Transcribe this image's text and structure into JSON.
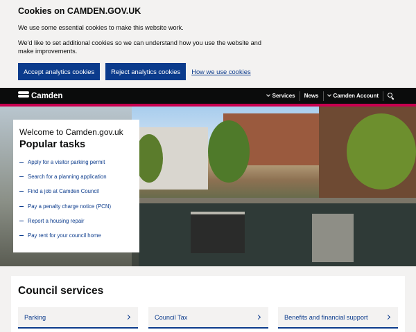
{
  "cookie_banner": {
    "title": "Cookies on CAMDEN.GOV.UK",
    "text1": "We use some essential cookies to make this website work.",
    "text2": "We'd like to set additional cookies so we can understand how you use the website and make improvements.",
    "accept_label": "Accept analytics cookies",
    "reject_label": "Reject analytics cookies",
    "link_label": "How we use cookies"
  },
  "header": {
    "logo_text": "Camden",
    "nav": [
      "Services",
      "News",
      "Camden Account"
    ],
    "search_icon": "search-icon",
    "accent_color": "#c8004f"
  },
  "tasks": {
    "welcome": "Welcome to Camden.gov.uk",
    "title": "Popular tasks",
    "items": [
      "Apply for a visitor parking permit",
      "Search for a planning application",
      "Find a job at Camden Council",
      "Pay a penalty charge notice (PCN)",
      "Report a housing repair",
      "Pay rent for your council home"
    ]
  },
  "services": {
    "title": "Council services",
    "items": [
      "Parking",
      "Council Tax",
      "Benefits and financial support"
    ]
  },
  "colors": {
    "link": "#0b3b8c",
    "button": "#0b3b8c",
    "header": "#0b0c0c"
  }
}
